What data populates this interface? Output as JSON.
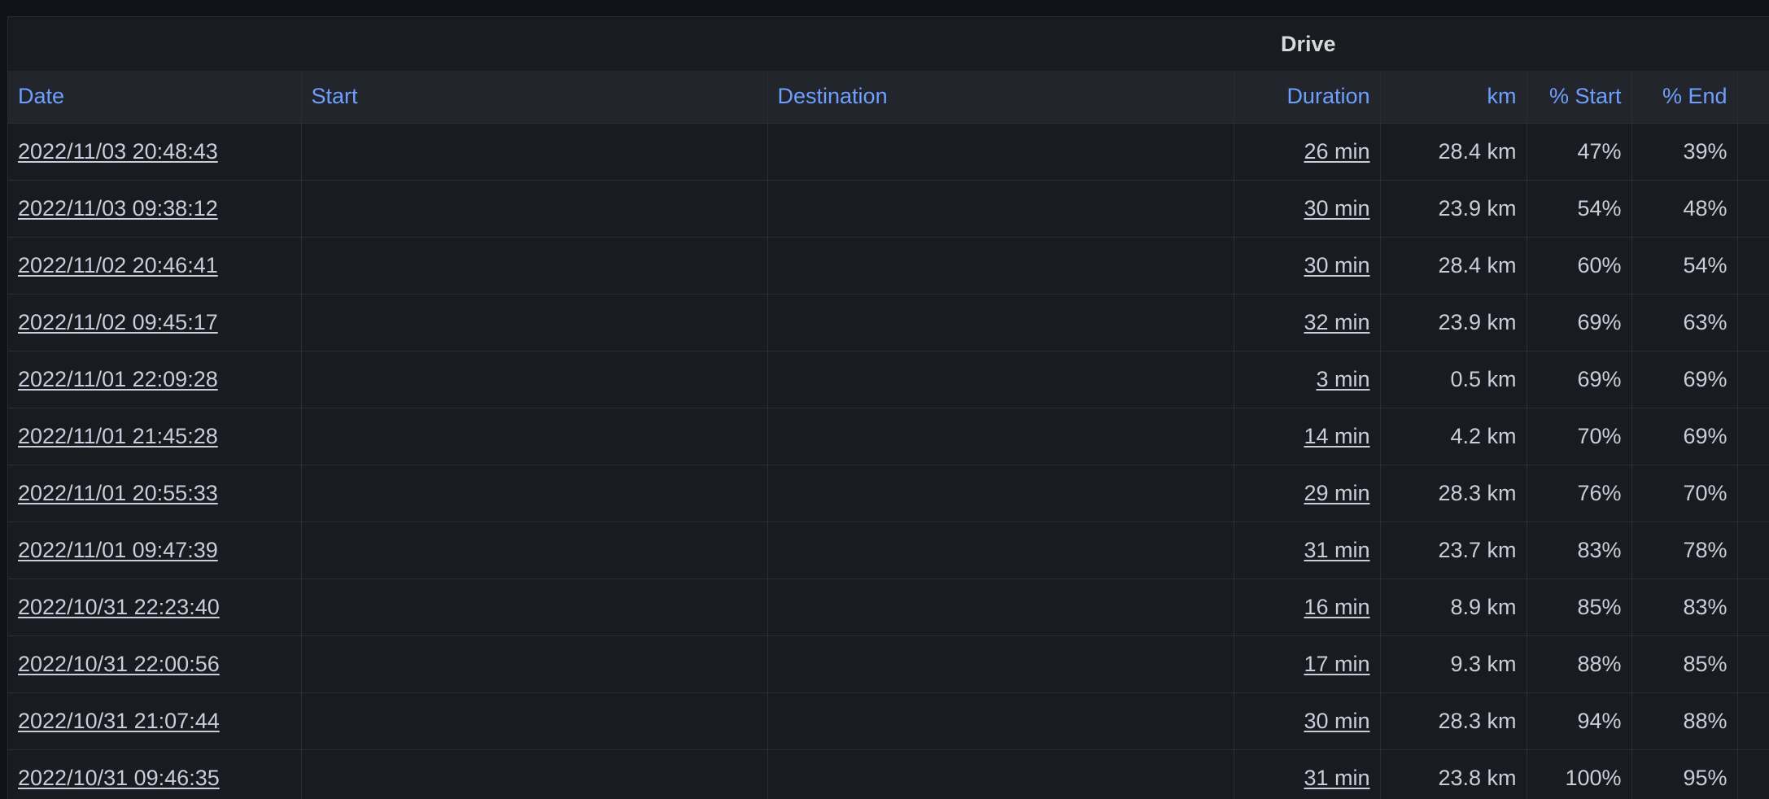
{
  "panel": {
    "title": "Drive"
  },
  "columns": {
    "date": "Date",
    "start": "Start",
    "destination": "Destination",
    "duration": "Duration",
    "km": "km",
    "pct_start": "% Start",
    "pct_end": "% End"
  },
  "rows": [
    {
      "date": "2022/11/03 20:48:43",
      "start": "",
      "destination": "",
      "duration": "26 min",
      "km": "28.4 km",
      "pct_start": "47%",
      "pct_end": "39%"
    },
    {
      "date": "2022/11/03 09:38:12",
      "start": "",
      "destination": "",
      "duration": "30 min",
      "km": "23.9 km",
      "pct_start": "54%",
      "pct_end": "48%"
    },
    {
      "date": "2022/11/02 20:46:41",
      "start": "",
      "destination": "",
      "duration": "30 min",
      "km": "28.4 km",
      "pct_start": "60%",
      "pct_end": "54%"
    },
    {
      "date": "2022/11/02 09:45:17",
      "start": "",
      "destination": "",
      "duration": "32 min",
      "km": "23.9 km",
      "pct_start": "69%",
      "pct_end": "63%"
    },
    {
      "date": "2022/11/01 22:09:28",
      "start": "",
      "destination": "",
      "duration": "3 min",
      "km": "0.5 km",
      "pct_start": "69%",
      "pct_end": "69%"
    },
    {
      "date": "2022/11/01 21:45:28",
      "start": "",
      "destination": "",
      "duration": "14 min",
      "km": "4.2 km",
      "pct_start": "70%",
      "pct_end": "69%"
    },
    {
      "date": "2022/11/01 20:55:33",
      "start": "",
      "destination": "",
      "duration": "29 min",
      "km": "28.3 km",
      "pct_start": "76%",
      "pct_end": "70%"
    },
    {
      "date": "2022/11/01 09:47:39",
      "start": "",
      "destination": "",
      "duration": "31 min",
      "km": "23.7 km",
      "pct_start": "83%",
      "pct_end": "78%"
    },
    {
      "date": "2022/10/31 22:23:40",
      "start": "",
      "destination": "",
      "duration": "16 min",
      "km": "8.9 km",
      "pct_start": "85%",
      "pct_end": "83%"
    },
    {
      "date": "2022/10/31 22:00:56",
      "start": "",
      "destination": "",
      "duration": "17 min",
      "km": "9.3 km",
      "pct_start": "88%",
      "pct_end": "85%"
    },
    {
      "date": "2022/10/31 21:07:44",
      "start": "",
      "destination": "",
      "duration": "30 min",
      "km": "28.3 km",
      "pct_start": "94%",
      "pct_end": "88%"
    },
    {
      "date": "2022/10/31 09:46:35",
      "start": "",
      "destination": "",
      "duration": "31 min",
      "km": "23.8 km",
      "pct_start": "100%",
      "pct_end": "95%"
    }
  ],
  "colors": {
    "background": "#111217",
    "panel": "#181b1f",
    "header_row": "#22252b",
    "header_text": "#6e9fff",
    "cell_text": "#ccccdc"
  }
}
